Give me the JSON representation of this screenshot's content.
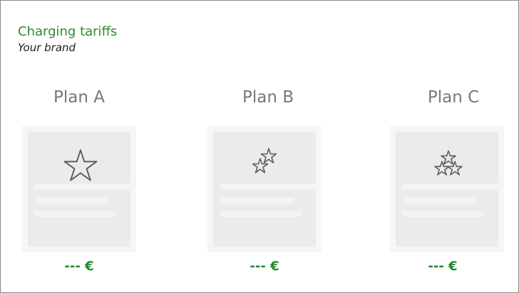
{
  "header": {
    "title": "Charging tariffs",
    "subtitle": "Your brand"
  },
  "colors": {
    "accent": "#2e8b2e",
    "price": "#1f8a2e",
    "plan_name": "#777777",
    "card_bg": "#ebebeb"
  },
  "plans": [
    {
      "name": "Plan A",
      "icon": "single-star-icon",
      "price": "--- €"
    },
    {
      "name": "Plan B",
      "icon": "two-stars-icon",
      "price": "--- €"
    },
    {
      "name": "Plan C",
      "icon": "three-stars-icon",
      "price": "--- €"
    }
  ]
}
